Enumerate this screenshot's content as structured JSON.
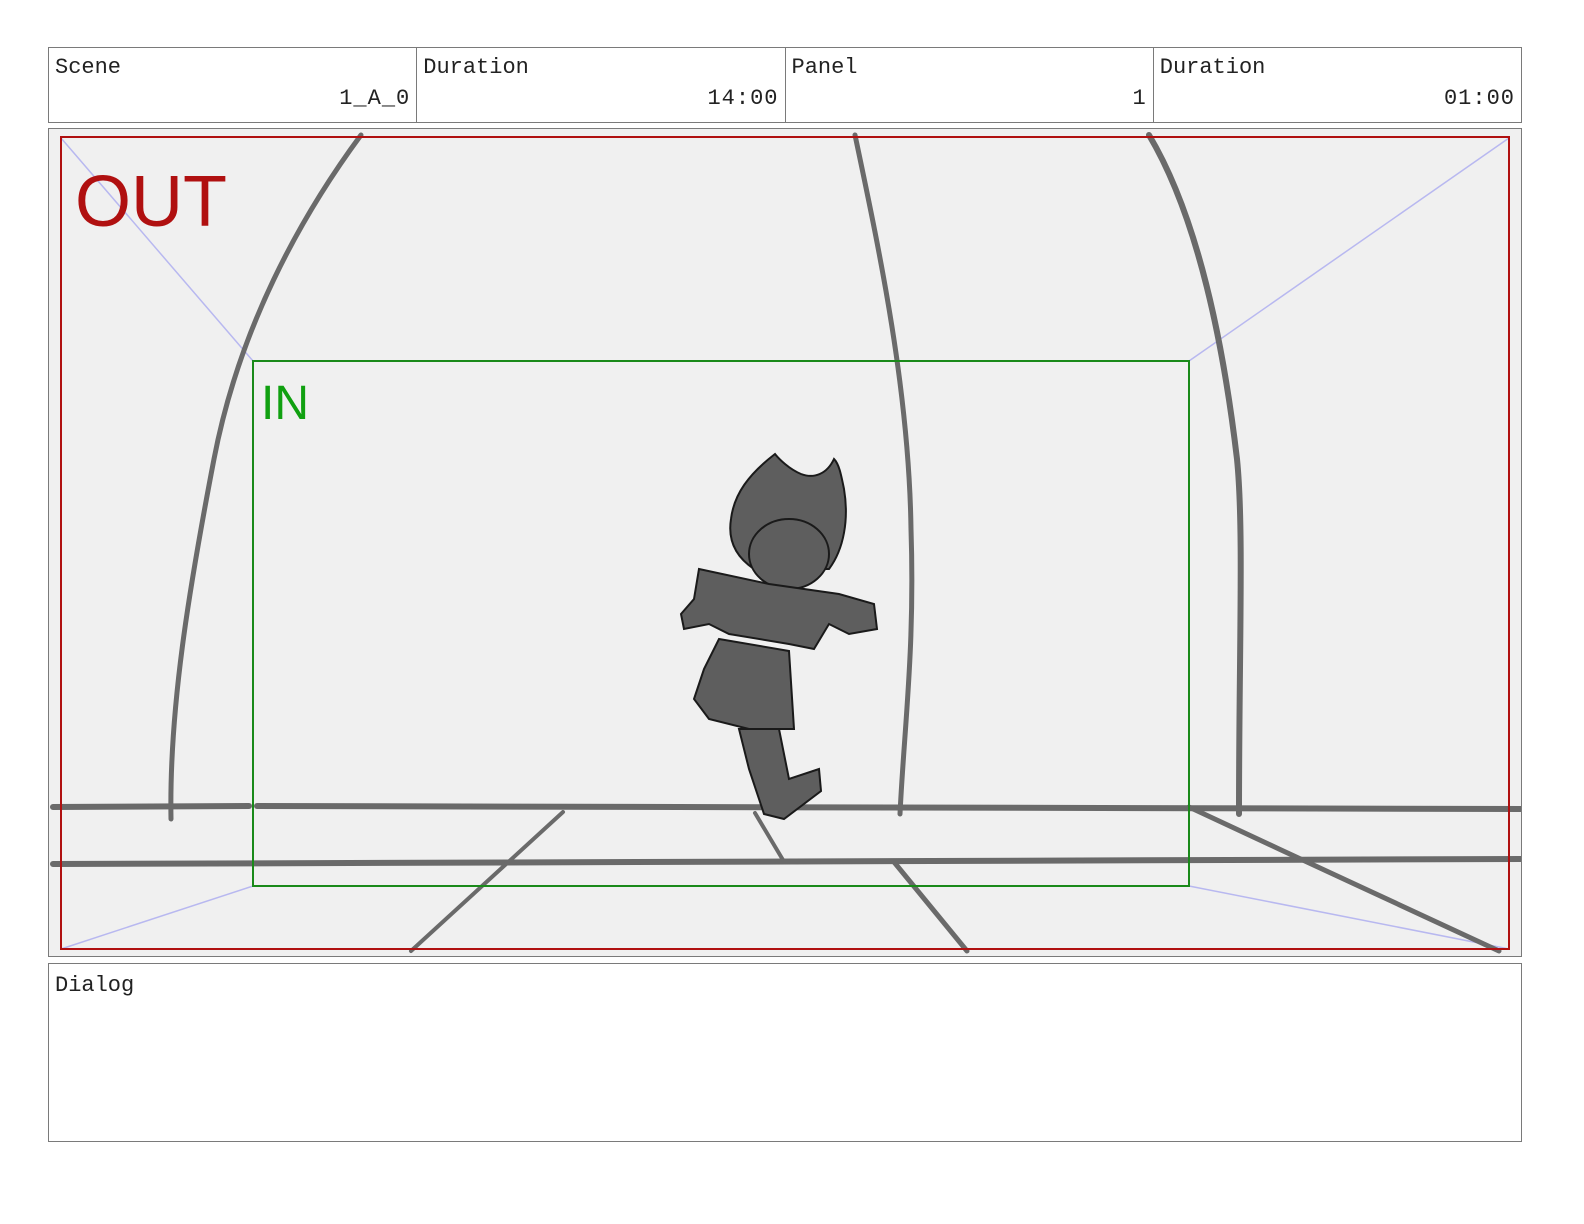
{
  "header": {
    "cells": [
      {
        "label": "Scene",
        "value": "1_A_0"
      },
      {
        "label": "Duration",
        "value": "14:00"
      },
      {
        "label": "Panel",
        "value": "1"
      },
      {
        "label": "Duration",
        "value": "01:00"
      }
    ]
  },
  "panel": {
    "out_label": "OUT",
    "in_label": "IN",
    "colors": {
      "out_frame": "#b01010",
      "in_frame": "#1a8a1a",
      "in_text": "#10a010",
      "guides": "#b8b8f0",
      "sketch": "#6a6a6a",
      "background": "#f0f0f0"
    }
  },
  "dialog": {
    "label": "Dialog",
    "text": ""
  }
}
